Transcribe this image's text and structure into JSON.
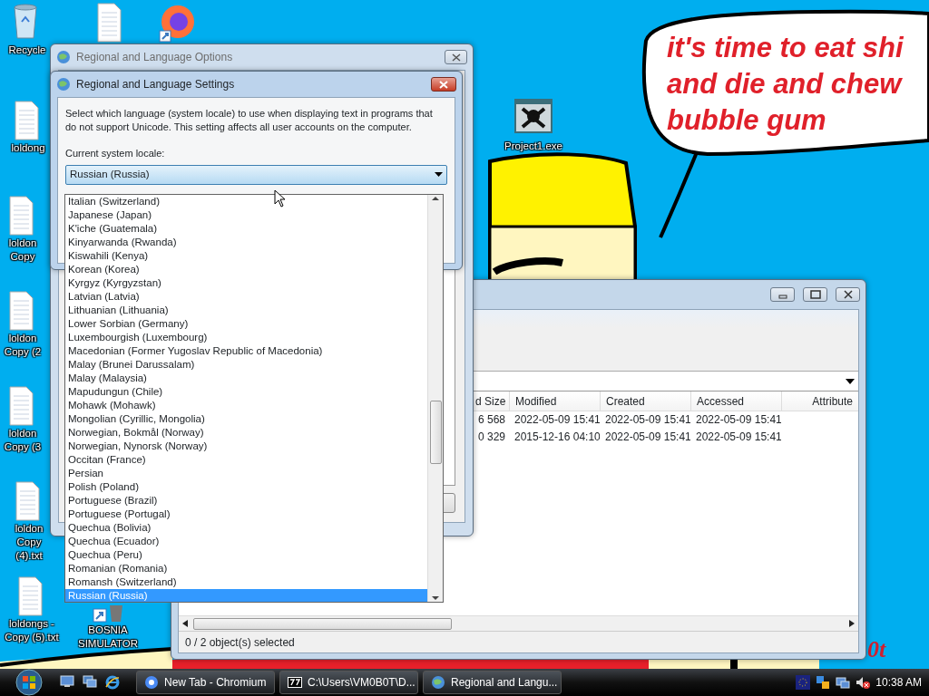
{
  "desktop": {
    "icons": [
      {
        "kind": "recycle",
        "label": "Recycle"
      },
      {
        "kind": "text"
      },
      {
        "kind": "browser"
      },
      {
        "kind": "text",
        "label": "loldong"
      },
      {
        "kind": "text",
        "label": "loldon Copy"
      },
      {
        "kind": "text",
        "label": "loldon Copy (2"
      },
      {
        "kind": "text",
        "label": "loldon Copy (3"
      },
      {
        "kind": "text",
        "label": "loldon Copy (4).txt"
      },
      {
        "kind": "text",
        "label": "loldongs - Copy (5).txt"
      },
      {
        "kind": "shortcut",
        "label": "BOSNIA SIMULATOR"
      },
      {
        "kind": "exe",
        "label": "Project1.exe"
      }
    ],
    "wallpaper": {
      "bubble_lines": [
        "it's time to eat shi",
        "and die and chew",
        "bubble gum"
      ],
      "corner_text": "0t"
    }
  },
  "options_window": {
    "title": "Regional and Language Options"
  },
  "settings_dialog": {
    "title": "Regional and Language Settings",
    "description": "Select which language (system locale) to use when displaying text in programs that do not support Unicode. This setting affects all user accounts on the computer.",
    "locale_label": "Current system locale:",
    "locale_value": "Russian (Russia)",
    "locale_options": [
      {
        "label": "Italian (Switzerland)",
        "selected": false
      },
      {
        "label": "Japanese (Japan)",
        "selected": false
      },
      {
        "label": "K'iche (Guatemala)",
        "selected": false
      },
      {
        "label": "Kinyarwanda (Rwanda)",
        "selected": false
      },
      {
        "label": "Kiswahili (Kenya)",
        "selected": false
      },
      {
        "label": "Korean (Korea)",
        "selected": false
      },
      {
        "label": "Kyrgyz (Kyrgyzstan)",
        "selected": false
      },
      {
        "label": "Latvian (Latvia)",
        "selected": false
      },
      {
        "label": "Lithuanian (Lithuania)",
        "selected": false
      },
      {
        "label": "Lower Sorbian (Germany)",
        "selected": false
      },
      {
        "label": "Luxembourgish (Luxembourg)",
        "selected": false
      },
      {
        "label": "Macedonian (Former Yugoslav Republic of Macedonia)",
        "selected": false
      },
      {
        "label": "Malay (Brunei Darussalam)",
        "selected": false
      },
      {
        "label": "Malay (Malaysia)",
        "selected": false
      },
      {
        "label": "Mapudungun (Chile)",
        "selected": false
      },
      {
        "label": "Mohawk (Mohawk)",
        "selected": false
      },
      {
        "label": "Mongolian (Cyrillic, Mongolia)",
        "selected": false
      },
      {
        "label": "Norwegian, Bokmål (Norway)",
        "selected": false
      },
      {
        "label": "Norwegian, Nynorsk (Norway)",
        "selected": false
      },
      {
        "label": "Occitan (France)",
        "selected": false
      },
      {
        "label": "Persian",
        "selected": false
      },
      {
        "label": "Polish (Poland)",
        "selected": false
      },
      {
        "label": "Portuguese (Brazil)",
        "selected": false
      },
      {
        "label": "Portuguese (Portugal)",
        "selected": false
      },
      {
        "label": "Quechua (Bolivia)",
        "selected": false
      },
      {
        "label": "Quechua (Ecuador)",
        "selected": false
      },
      {
        "label": "Quechua (Peru)",
        "selected": false
      },
      {
        "label": "Romanian (Romania)",
        "selected": false
      },
      {
        "label": "Romansh (Switzerland)",
        "selected": false
      },
      {
        "label": "Russian (Russia)",
        "selected": true
      }
    ]
  },
  "file_window": {
    "columns": [
      "d Size",
      "Modified",
      "Created",
      "Accessed",
      "Attribute"
    ],
    "rows": [
      [
        "6 568",
        "2022-05-09 15:41",
        "2022-05-09 15:41",
        "2022-05-09 15:41"
      ],
      [
        "0 329",
        "2015-12-16 04:10",
        "2022-05-09 15:41",
        "2022-05-09 15:41"
      ]
    ],
    "status_bar": "0 / 2 object(s) selected"
  },
  "taskbar": {
    "buttons": [
      {
        "kind": "browser",
        "label": "New Tab - Chromium"
      },
      {
        "kind": "archive",
        "label": "C:\\Users\\VM0B0T\\D..."
      },
      {
        "kind": "globe",
        "label": "Regional and Langu..."
      }
    ],
    "clock": "10:38 AM"
  }
}
